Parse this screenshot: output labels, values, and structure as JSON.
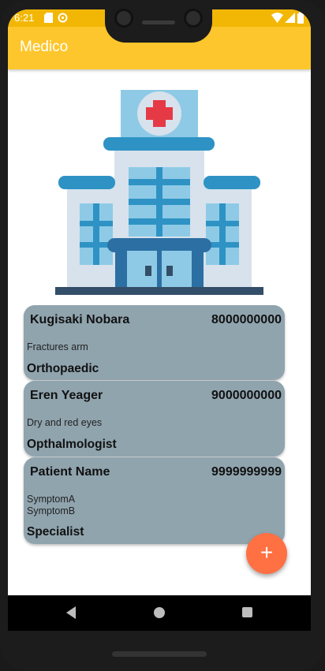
{
  "status_bar": {
    "time": "6:21"
  },
  "app_bar": {
    "title": "Medico"
  },
  "patients": [
    {
      "name": "Kugisaki Nobara",
      "phone": "8000000000",
      "symptoms": "Fractures arm",
      "specialist": "Orthopaedic"
    },
    {
      "name": "Eren Yeager",
      "phone": "9000000000",
      "symptoms": "Dry and red eyes",
      "specialist": "Opthalmologist"
    },
    {
      "name": "Patient Name",
      "phone": "9999999999",
      "symptoms": "SymptomA\nSymptomB",
      "specialist": "Specialist"
    }
  ],
  "fab": {
    "label": "+"
  },
  "icons": {
    "hero": "hospital-building-icon",
    "status": [
      "sd-card-icon",
      "sync-icon",
      "wifi-icon",
      "cellular-signal-icon",
      "battery-icon"
    ],
    "nav": [
      "back-icon",
      "home-icon",
      "recents-icon"
    ]
  },
  "colors": {
    "app_bar": "#fdc62c",
    "status_bar": "#f2b705",
    "card": "#90a4ae",
    "fab": "#ff7043"
  }
}
